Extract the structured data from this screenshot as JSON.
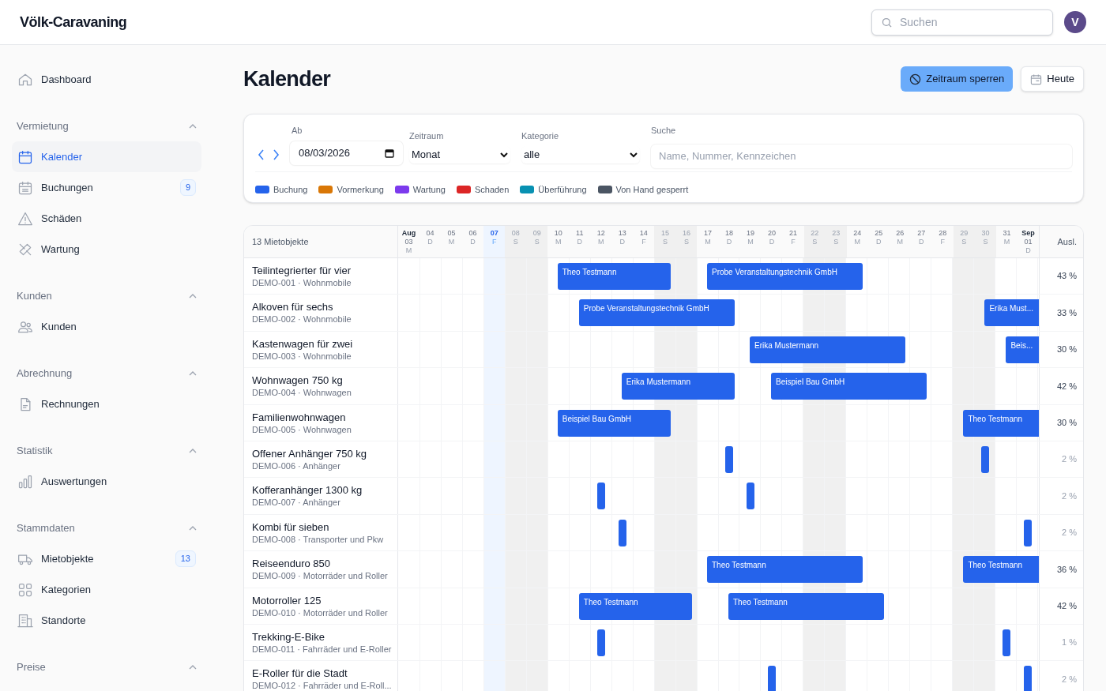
{
  "app": {
    "logo": "Völk-Caravaning",
    "search": {
      "placeholder": "Suchen"
    },
    "avatar": "V"
  },
  "sidebar": {
    "top_item": {
      "label": "Dashboard",
      "selected": false
    },
    "groups": [
      {
        "title": "Vermietung",
        "expanded": true,
        "items": [
          {
            "label": "Kalender",
            "selected": true
          },
          {
            "label": "Buchungen",
            "selected": false,
            "badge": "9"
          },
          {
            "label": "Schäden",
            "selected": false
          },
          {
            "label": "Wartung",
            "selected": false
          }
        ]
      },
      {
        "title": "Kunden",
        "expanded": true,
        "items": [
          {
            "label": "Kunden",
            "selected": false
          }
        ]
      },
      {
        "title": "Abrechnung",
        "expanded": true,
        "items": [
          {
            "label": "Rechnungen",
            "selected": false
          }
        ]
      },
      {
        "title": "Statistik",
        "expanded": true,
        "items": [
          {
            "label": "Auswertungen",
            "selected": false
          }
        ]
      },
      {
        "title": "Stammdaten",
        "expanded": true,
        "items": [
          {
            "label": "Mietobjekte",
            "selected": false,
            "badge": "13"
          },
          {
            "label": "Kategorien",
            "selected": false
          },
          {
            "label": "Standorte",
            "selected": false
          }
        ]
      },
      {
        "title": "Preise",
        "expanded": true
      }
    ]
  },
  "page": {
    "title": "Kalender",
    "buttons": [
      {
        "label": "Zeitraum sperren",
        "kind": "primary"
      },
      {
        "label": "Heute",
        "kind": "secondary"
      }
    ]
  },
  "filters": {
    "ab": {
      "label": "Ab",
      "value": "08/03/2026"
    },
    "zeitraum": {
      "label": "Zeitraum",
      "value": "Monat"
    },
    "kategorie": {
      "label": "Kategorie",
      "value": "alle"
    },
    "suche": {
      "label": "Suche",
      "placeholder": "Name, Nummer, Kennzeichen"
    },
    "legend": [
      {
        "label": "Buchung",
        "color": "#2563eb"
      },
      {
        "label": "Vormerkung",
        "color": "#d97706"
      },
      {
        "label": "Wartung",
        "color": "#7c3aed"
      },
      {
        "label": "Schaden",
        "color": "#dc2626"
      },
      {
        "label": "Überführung",
        "color": "#0891b2"
      },
      {
        "label": "Von Hand gesperrt",
        "color": "#4b5563"
      }
    ]
  },
  "calendar": {
    "count_label": "13 Mietobjekte",
    "util_header": "Ausl.",
    "days": [
      {
        "month": "Aug",
        "day": "03",
        "weekday": "M",
        "weekend": false,
        "today": false
      },
      {
        "day": "04",
        "weekday": "D",
        "weekend": false,
        "today": false
      },
      {
        "day": "05",
        "weekday": "M",
        "weekend": false,
        "today": false
      },
      {
        "day": "06",
        "weekday": "D",
        "weekend": false,
        "today": false
      },
      {
        "day": "07",
        "weekday": "F",
        "weekend": false,
        "today": true
      },
      {
        "day": "08",
        "weekday": "S",
        "weekend": true,
        "today": false
      },
      {
        "day": "09",
        "weekday": "S",
        "weekend": true,
        "today": false
      },
      {
        "day": "10",
        "weekday": "M",
        "weekend": false,
        "today": false
      },
      {
        "day": "11",
        "weekday": "D",
        "weekend": false,
        "today": false
      },
      {
        "day": "12",
        "weekday": "M",
        "weekend": false,
        "today": false
      },
      {
        "day": "13",
        "weekday": "D",
        "weekend": false,
        "today": false
      },
      {
        "day": "14",
        "weekday": "F",
        "weekend": false,
        "today": false
      },
      {
        "day": "15",
        "weekday": "S",
        "weekend": true,
        "today": false
      },
      {
        "day": "16",
        "weekday": "S",
        "weekend": true,
        "today": false
      },
      {
        "day": "17",
        "weekday": "M",
        "weekend": false,
        "today": false
      },
      {
        "day": "18",
        "weekday": "D",
        "weekend": false,
        "today": false
      },
      {
        "day": "19",
        "weekday": "M",
        "weekend": false,
        "today": false
      },
      {
        "day": "20",
        "weekday": "D",
        "weekend": false,
        "today": false
      },
      {
        "day": "21",
        "weekday": "F",
        "weekend": false,
        "today": false
      },
      {
        "day": "22",
        "weekday": "S",
        "weekend": true,
        "today": false
      },
      {
        "day": "23",
        "weekday": "S",
        "weekend": true,
        "today": false
      },
      {
        "day": "24",
        "weekday": "M",
        "weekend": false,
        "today": false
      },
      {
        "day": "25",
        "weekday": "D",
        "weekend": false,
        "today": false
      },
      {
        "day": "26",
        "weekday": "M",
        "weekend": false,
        "today": false
      },
      {
        "day": "27",
        "weekday": "D",
        "weekend": false,
        "today": false
      },
      {
        "day": "28",
        "weekday": "F",
        "weekend": false,
        "today": false
      },
      {
        "day": "29",
        "weekday": "S",
        "weekend": true,
        "today": false
      },
      {
        "day": "30",
        "weekday": "S",
        "weekend": true,
        "today": false
      },
      {
        "day": "31",
        "weekday": "M",
        "weekend": false,
        "today": false
      },
      {
        "month": "Sep",
        "day": "01",
        "weekday": "D",
        "weekend": false,
        "today": false
      }
    ],
    "rows": [
      {
        "name": "Teilintegrierter für vier",
        "meta": "DEMO-001 · Wohnmobile",
        "utilization": "43 %",
        "low": false,
        "cells": [
          {
            "kind": "free"
          },
          {
            "kind": "free"
          },
          {
            "kind": "free"
          },
          {
            "kind": "free"
          },
          {
            "kind": "free"
          },
          {
            "kind": "free"
          },
          {
            "kind": "free"
          },
          {
            "kind": "start",
            "label": "Theo Testmann"
          },
          {
            "kind": "mid"
          },
          {
            "kind": "mid"
          },
          {
            "kind": "mid"
          },
          {
            "kind": "mid"
          },
          {
            "kind": "end"
          },
          {
            "kind": "free"
          },
          {
            "kind": "start",
            "label": "Probe Veranstaltungstechnik GmbH"
          },
          {
            "kind": "mid"
          },
          {
            "kind": "mid"
          },
          {
            "kind": "mid"
          },
          {
            "kind": "mid"
          },
          {
            "kind": "mid"
          },
          {
            "kind": "mid"
          },
          {
            "kind": "end"
          },
          {
            "kind": "free"
          },
          {
            "kind": "free"
          },
          {
            "kind": "free"
          },
          {
            "kind": "free"
          },
          {
            "kind": "free"
          },
          {
            "kind": "free"
          },
          {
            "kind": "free"
          },
          {
            "kind": "free"
          }
        ]
      },
      {
        "name": "Alkoven für sechs",
        "meta": "DEMO-002 · Wohnmobile",
        "utilization": "33 %",
        "low": false,
        "cells": [
          {
            "kind": "free"
          },
          {
            "kind": "free"
          },
          {
            "kind": "free"
          },
          {
            "kind": "free"
          },
          {
            "kind": "free"
          },
          {
            "kind": "free"
          },
          {
            "kind": "free"
          },
          {
            "kind": "free"
          },
          {
            "kind": "start",
            "label": "Probe Veranstaltungstechnik GmbH"
          },
          {
            "kind": "mid"
          },
          {
            "kind": "mid"
          },
          {
            "kind": "mid"
          },
          {
            "kind": "mid"
          },
          {
            "kind": "mid"
          },
          {
            "kind": "mid"
          },
          {
            "kind": "end"
          },
          {
            "kind": "free"
          },
          {
            "kind": "free"
          },
          {
            "kind": "free"
          },
          {
            "kind": "free"
          },
          {
            "kind": "free"
          },
          {
            "kind": "free"
          },
          {
            "kind": "free"
          },
          {
            "kind": "free"
          },
          {
            "kind": "free"
          },
          {
            "kind": "free"
          },
          {
            "kind": "free"
          },
          {
            "kind": "start",
            "label": "Erika Must..."
          },
          {
            "kind": "mid"
          },
          {
            "kind": "mid"
          }
        ]
      },
      {
        "name": "Kastenwagen für zwei",
        "meta": "DEMO-003 · Wohnmobile",
        "utilization": "30 %",
        "low": false,
        "cells": [
          {
            "kind": "free"
          },
          {
            "kind": "free"
          },
          {
            "kind": "free"
          },
          {
            "kind": "free"
          },
          {
            "kind": "free"
          },
          {
            "kind": "free"
          },
          {
            "kind": "free"
          },
          {
            "kind": "free"
          },
          {
            "kind": "free"
          },
          {
            "kind": "free"
          },
          {
            "kind": "free"
          },
          {
            "kind": "free"
          },
          {
            "kind": "free"
          },
          {
            "kind": "free"
          },
          {
            "kind": "free"
          },
          {
            "kind": "free"
          },
          {
            "kind": "start",
            "label": "Erika Mustermann"
          },
          {
            "kind": "mid"
          },
          {
            "kind": "mid"
          },
          {
            "kind": "mid"
          },
          {
            "kind": "mid"
          },
          {
            "kind": "mid"
          },
          {
            "kind": "mid"
          },
          {
            "kind": "end"
          },
          {
            "kind": "free"
          },
          {
            "kind": "free"
          },
          {
            "kind": "free"
          },
          {
            "kind": "free"
          },
          {
            "kind": "start",
            "label": "Beis..."
          },
          {
            "kind": "mid"
          }
        ]
      },
      {
        "name": "Wohnwagen 750 kg",
        "meta": "DEMO-004 · Wohnwagen",
        "utilization": "42 %",
        "low": false,
        "cells": [
          {
            "kind": "free"
          },
          {
            "kind": "free"
          },
          {
            "kind": "free"
          },
          {
            "kind": "free"
          },
          {
            "kind": "free"
          },
          {
            "kind": "free"
          },
          {
            "kind": "free"
          },
          {
            "kind": "free"
          },
          {
            "kind": "free"
          },
          {
            "kind": "free"
          },
          {
            "kind": "start",
            "label": "Erika Mustermann"
          },
          {
            "kind": "mid"
          },
          {
            "kind": "mid"
          },
          {
            "kind": "mid"
          },
          {
            "kind": "mid"
          },
          {
            "kind": "end"
          },
          {
            "kind": "free"
          },
          {
            "kind": "start",
            "label": "Beispiel Bau GmbH"
          },
          {
            "kind": "mid"
          },
          {
            "kind": "mid"
          },
          {
            "kind": "mid"
          },
          {
            "kind": "mid"
          },
          {
            "kind": "mid"
          },
          {
            "kind": "mid"
          },
          {
            "kind": "end"
          },
          {
            "kind": "free"
          },
          {
            "kind": "free"
          },
          {
            "kind": "free"
          },
          {
            "kind": "free"
          },
          {
            "kind": "free"
          }
        ]
      },
      {
        "name": "Familienwohnwagen",
        "meta": "DEMO-005 · Wohnwagen",
        "utilization": "30 %",
        "low": false,
        "cells": [
          {
            "kind": "free"
          },
          {
            "kind": "free"
          },
          {
            "kind": "free"
          },
          {
            "kind": "free"
          },
          {
            "kind": "free"
          },
          {
            "kind": "free"
          },
          {
            "kind": "free"
          },
          {
            "kind": "start",
            "label": "Beispiel Bau GmbH"
          },
          {
            "kind": "mid"
          },
          {
            "kind": "mid"
          },
          {
            "kind": "mid"
          },
          {
            "kind": "mid"
          },
          {
            "kind": "end"
          },
          {
            "kind": "free"
          },
          {
            "kind": "free"
          },
          {
            "kind": "free"
          },
          {
            "kind": "free"
          },
          {
            "kind": "free"
          },
          {
            "kind": "free"
          },
          {
            "kind": "free"
          },
          {
            "kind": "free"
          },
          {
            "kind": "free"
          },
          {
            "kind": "free"
          },
          {
            "kind": "free"
          },
          {
            "kind": "free"
          },
          {
            "kind": "free"
          },
          {
            "kind": "start",
            "label": "Theo Testmann"
          },
          {
            "kind": "mid"
          },
          {
            "kind": "mid"
          },
          {
            "kind": "mid"
          }
        ]
      },
      {
        "name": "Offener Anhänger 750 kg",
        "meta": "DEMO-006 · Anhänger",
        "utilization": "2 %",
        "low": true,
        "cells": [
          {
            "kind": "free"
          },
          {
            "kind": "free"
          },
          {
            "kind": "free"
          },
          {
            "kind": "free"
          },
          {
            "kind": "free"
          },
          {
            "kind": "free"
          },
          {
            "kind": "free"
          },
          {
            "kind": "free"
          },
          {
            "kind": "free"
          },
          {
            "kind": "free"
          },
          {
            "kind": "free"
          },
          {
            "kind": "free"
          },
          {
            "kind": "free"
          },
          {
            "kind": "free"
          },
          {
            "kind": "free"
          },
          {
            "kind": "single"
          },
          {
            "kind": "free"
          },
          {
            "kind": "free"
          },
          {
            "kind": "free"
          },
          {
            "kind": "free"
          },
          {
            "kind": "free"
          },
          {
            "kind": "free"
          },
          {
            "kind": "free"
          },
          {
            "kind": "free"
          },
          {
            "kind": "free"
          },
          {
            "kind": "free"
          },
          {
            "kind": "free"
          },
          {
            "kind": "single"
          },
          {
            "kind": "free"
          },
          {
            "kind": "free"
          }
        ]
      },
      {
        "name": "Kofferanhänger 1300 kg",
        "meta": "DEMO-007 · Anhänger",
        "utilization": "2 %",
        "low": true,
        "cells": [
          {
            "kind": "free"
          },
          {
            "kind": "free"
          },
          {
            "kind": "free"
          },
          {
            "kind": "free"
          },
          {
            "kind": "free"
          },
          {
            "kind": "free"
          },
          {
            "kind": "free"
          },
          {
            "kind": "free"
          },
          {
            "kind": "free"
          },
          {
            "kind": "single"
          },
          {
            "kind": "free"
          },
          {
            "kind": "free"
          },
          {
            "kind": "free"
          },
          {
            "kind": "free"
          },
          {
            "kind": "free"
          },
          {
            "kind": "free"
          },
          {
            "kind": "single"
          },
          {
            "kind": "free"
          },
          {
            "kind": "free"
          },
          {
            "kind": "free"
          },
          {
            "kind": "free"
          },
          {
            "kind": "free"
          },
          {
            "kind": "free"
          },
          {
            "kind": "free"
          },
          {
            "kind": "free"
          },
          {
            "kind": "free"
          },
          {
            "kind": "free"
          },
          {
            "kind": "free"
          },
          {
            "kind": "free"
          },
          {
            "kind": "free"
          }
        ]
      },
      {
        "name": "Kombi für sieben",
        "meta": "DEMO-008 · Transporter und Pkw",
        "utilization": "2 %",
        "low": true,
        "cells": [
          {
            "kind": "free"
          },
          {
            "kind": "free"
          },
          {
            "kind": "free"
          },
          {
            "kind": "free"
          },
          {
            "kind": "free"
          },
          {
            "kind": "free"
          },
          {
            "kind": "free"
          },
          {
            "kind": "free"
          },
          {
            "kind": "free"
          },
          {
            "kind": "free"
          },
          {
            "kind": "single"
          },
          {
            "kind": "free"
          },
          {
            "kind": "free"
          },
          {
            "kind": "free"
          },
          {
            "kind": "free"
          },
          {
            "kind": "free"
          },
          {
            "kind": "free"
          },
          {
            "kind": "free"
          },
          {
            "kind": "free"
          },
          {
            "kind": "free"
          },
          {
            "kind": "free"
          },
          {
            "kind": "free"
          },
          {
            "kind": "free"
          },
          {
            "kind": "free"
          },
          {
            "kind": "free"
          },
          {
            "kind": "free"
          },
          {
            "kind": "free"
          },
          {
            "kind": "free"
          },
          {
            "kind": "free"
          },
          {
            "kind": "single"
          }
        ]
      },
      {
        "name": "Reiseenduro 850",
        "meta": "DEMO-009 · Motorräder und Roller",
        "utilization": "36 %",
        "low": false,
        "cells": [
          {
            "kind": "free"
          },
          {
            "kind": "free"
          },
          {
            "kind": "free"
          },
          {
            "kind": "free"
          },
          {
            "kind": "free"
          },
          {
            "kind": "free"
          },
          {
            "kind": "free"
          },
          {
            "kind": "free"
          },
          {
            "kind": "free"
          },
          {
            "kind": "free"
          },
          {
            "kind": "free"
          },
          {
            "kind": "free"
          },
          {
            "kind": "free"
          },
          {
            "kind": "free"
          },
          {
            "kind": "start",
            "label": "Theo Testmann"
          },
          {
            "kind": "mid"
          },
          {
            "kind": "mid"
          },
          {
            "kind": "mid"
          },
          {
            "kind": "mid"
          },
          {
            "kind": "mid"
          },
          {
            "kind": "mid"
          },
          {
            "kind": "end"
          },
          {
            "kind": "free"
          },
          {
            "kind": "free"
          },
          {
            "kind": "free"
          },
          {
            "kind": "free"
          },
          {
            "kind": "start",
            "label": "Theo Testmann"
          },
          {
            "kind": "mid"
          },
          {
            "kind": "mid"
          },
          {
            "kind": "mid"
          }
        ]
      },
      {
        "name": "Motorroller 125",
        "meta": "DEMO-010 · Motorräder und Roller",
        "utilization": "42 %",
        "low": false,
        "cells": [
          {
            "kind": "free"
          },
          {
            "kind": "free"
          },
          {
            "kind": "free"
          },
          {
            "kind": "free"
          },
          {
            "kind": "free"
          },
          {
            "kind": "free"
          },
          {
            "kind": "free"
          },
          {
            "kind": "free"
          },
          {
            "kind": "start",
            "label": "Theo Testmann"
          },
          {
            "kind": "mid"
          },
          {
            "kind": "mid"
          },
          {
            "kind": "mid"
          },
          {
            "kind": "mid"
          },
          {
            "kind": "end"
          },
          {
            "kind": "free"
          },
          {
            "kind": "start",
            "label": "Theo Testmann"
          },
          {
            "kind": "mid"
          },
          {
            "kind": "mid"
          },
          {
            "kind": "mid"
          },
          {
            "kind": "mid"
          },
          {
            "kind": "mid"
          },
          {
            "kind": "mid"
          },
          {
            "kind": "end"
          },
          {
            "kind": "free"
          },
          {
            "kind": "free"
          },
          {
            "kind": "free"
          },
          {
            "kind": "free"
          },
          {
            "kind": "free"
          },
          {
            "kind": "free"
          },
          {
            "kind": "free"
          }
        ]
      },
      {
        "name": "Trekking-E-Bike",
        "meta": "DEMO-011 · Fahrräder und E-Roller",
        "utilization": "1 %",
        "low": true,
        "cells": [
          {
            "kind": "free"
          },
          {
            "kind": "free"
          },
          {
            "kind": "free"
          },
          {
            "kind": "free"
          },
          {
            "kind": "free"
          },
          {
            "kind": "free"
          },
          {
            "kind": "free"
          },
          {
            "kind": "free"
          },
          {
            "kind": "free"
          },
          {
            "kind": "single"
          },
          {
            "kind": "free"
          },
          {
            "kind": "free"
          },
          {
            "kind": "free"
          },
          {
            "kind": "free"
          },
          {
            "kind": "free"
          },
          {
            "kind": "free"
          },
          {
            "kind": "free"
          },
          {
            "kind": "free"
          },
          {
            "kind": "free"
          },
          {
            "kind": "free"
          },
          {
            "kind": "free"
          },
          {
            "kind": "free"
          },
          {
            "kind": "free"
          },
          {
            "kind": "free"
          },
          {
            "kind": "free"
          },
          {
            "kind": "free"
          },
          {
            "kind": "free"
          },
          {
            "kind": "free"
          },
          {
            "kind": "single"
          },
          {
            "kind": "free"
          }
        ]
      },
      {
        "name": "E-Roller für die Stadt",
        "meta": "DEMO-012 · Fahrräder und E-Roll...",
        "utilization": "2 %",
        "low": true,
        "cells": [
          {
            "kind": "free"
          },
          {
            "kind": "free"
          },
          {
            "kind": "free"
          },
          {
            "kind": "free"
          },
          {
            "kind": "free"
          },
          {
            "kind": "free"
          },
          {
            "kind": "free"
          },
          {
            "kind": "free"
          },
          {
            "kind": "free"
          },
          {
            "kind": "free"
          },
          {
            "kind": "free"
          },
          {
            "kind": "free"
          },
          {
            "kind": "free"
          },
          {
            "kind": "free"
          },
          {
            "kind": "free"
          },
          {
            "kind": "free"
          },
          {
            "kind": "free"
          },
          {
            "kind": "single"
          },
          {
            "kind": "free"
          },
          {
            "kind": "free"
          },
          {
            "kind": "free"
          },
          {
            "kind": "free"
          },
          {
            "kind": "free"
          },
          {
            "kind": "free"
          },
          {
            "kind": "free"
          },
          {
            "kind": "free"
          },
          {
            "kind": "free"
          },
          {
            "kind": "free"
          },
          {
            "kind": "free"
          },
          {
            "kind": "single"
          }
        ]
      }
    ]
  }
}
